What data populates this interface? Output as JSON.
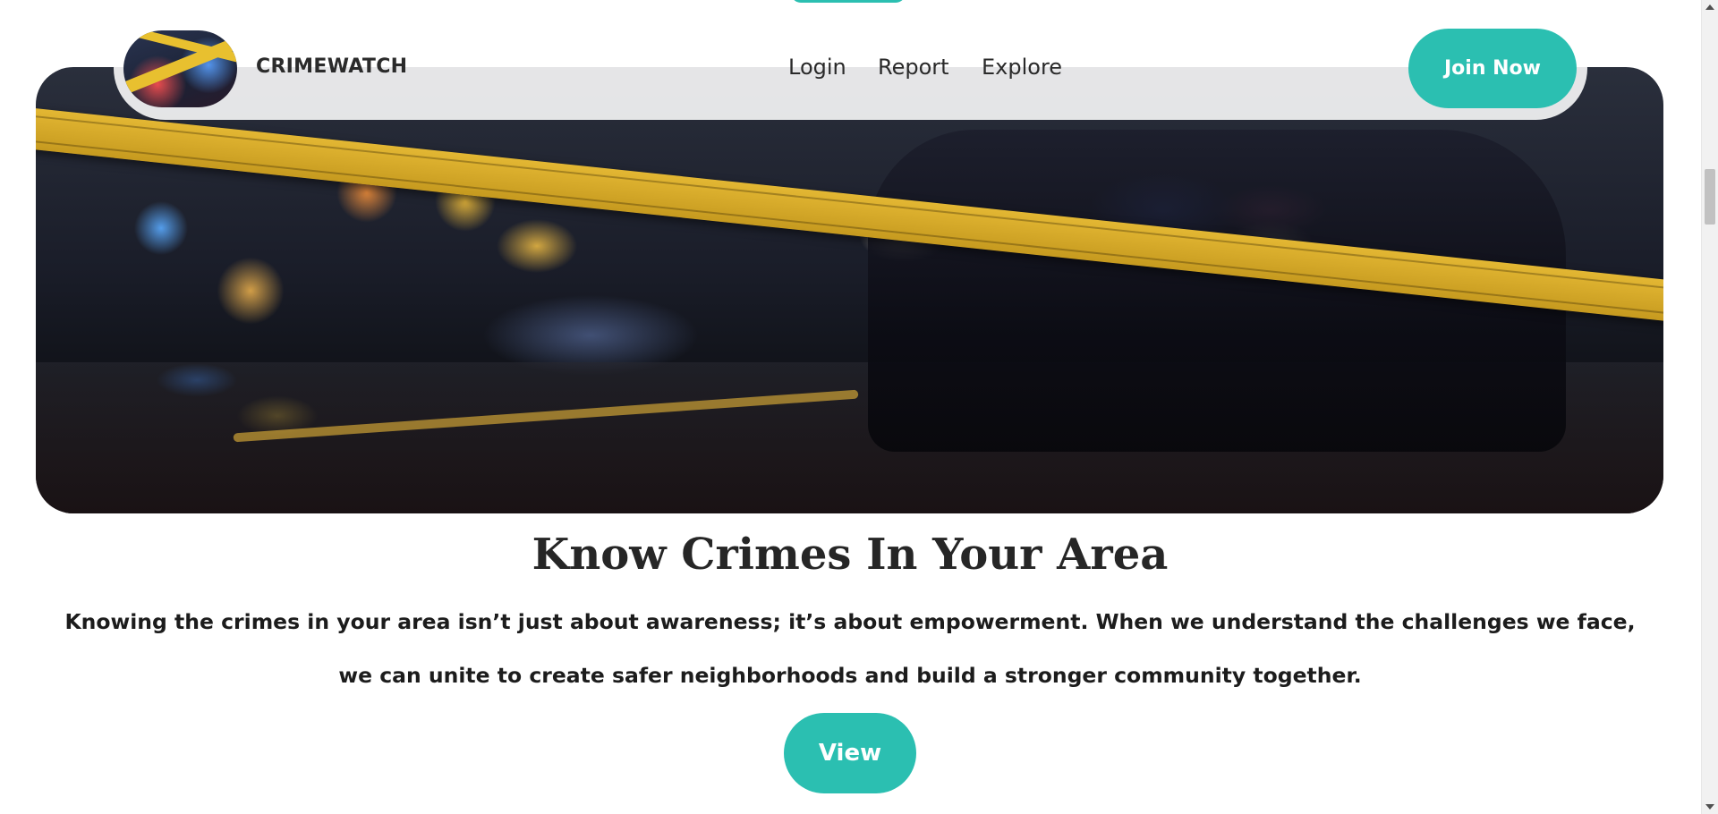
{
  "header": {
    "brand": "CRIMEWATCH",
    "nav": [
      "Login",
      "Report",
      "Explore"
    ],
    "cta_label": "Join Now",
    "accent_color": "#2bbfb1"
  },
  "hero": {
    "image_description_icon": "crime-scene-photo"
  },
  "main": {
    "title": "Know Crimes In Your Area",
    "description": "Knowing the crimes in your area isn’t just about awareness; it’s about empowerment. When we understand the challenges we face, we can unite to create safer neighborhoods and build a stronger community together.",
    "view_label": "View"
  }
}
